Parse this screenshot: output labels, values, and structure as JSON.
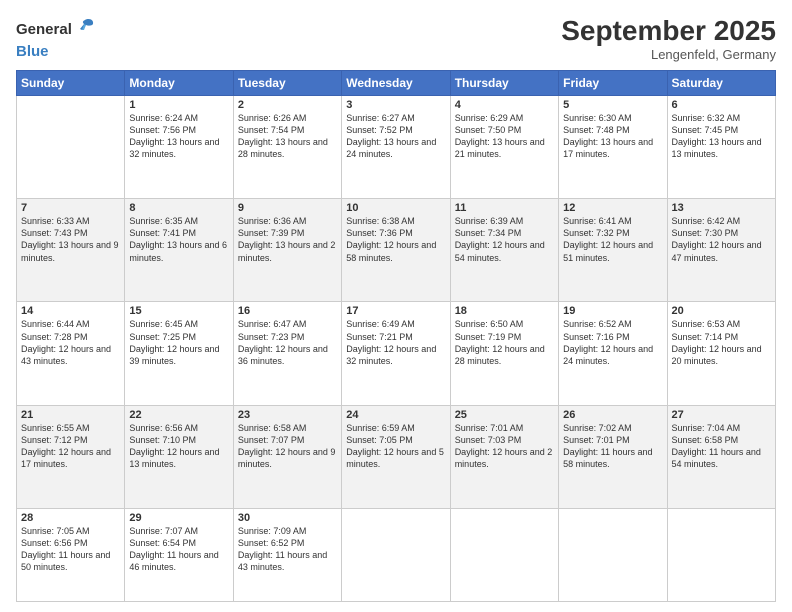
{
  "header": {
    "logo_general": "General",
    "logo_blue": "Blue",
    "month_title": "September 2025",
    "location": "Lengenfeld, Germany"
  },
  "days_of_week": [
    "Sunday",
    "Monday",
    "Tuesday",
    "Wednesday",
    "Thursday",
    "Friday",
    "Saturday"
  ],
  "weeks": [
    [
      {
        "day": "",
        "sunrise": "",
        "sunset": "",
        "daylight": ""
      },
      {
        "day": "1",
        "sunrise": "Sunrise: 6:24 AM",
        "sunset": "Sunset: 7:56 PM",
        "daylight": "Daylight: 13 hours and 32 minutes."
      },
      {
        "day": "2",
        "sunrise": "Sunrise: 6:26 AM",
        "sunset": "Sunset: 7:54 PM",
        "daylight": "Daylight: 13 hours and 28 minutes."
      },
      {
        "day": "3",
        "sunrise": "Sunrise: 6:27 AM",
        "sunset": "Sunset: 7:52 PM",
        "daylight": "Daylight: 13 hours and 24 minutes."
      },
      {
        "day": "4",
        "sunrise": "Sunrise: 6:29 AM",
        "sunset": "Sunset: 7:50 PM",
        "daylight": "Daylight: 13 hours and 21 minutes."
      },
      {
        "day": "5",
        "sunrise": "Sunrise: 6:30 AM",
        "sunset": "Sunset: 7:48 PM",
        "daylight": "Daylight: 13 hours and 17 minutes."
      },
      {
        "day": "6",
        "sunrise": "Sunrise: 6:32 AM",
        "sunset": "Sunset: 7:45 PM",
        "daylight": "Daylight: 13 hours and 13 minutes."
      }
    ],
    [
      {
        "day": "7",
        "sunrise": "Sunrise: 6:33 AM",
        "sunset": "Sunset: 7:43 PM",
        "daylight": "Daylight: 13 hours and 9 minutes."
      },
      {
        "day": "8",
        "sunrise": "Sunrise: 6:35 AM",
        "sunset": "Sunset: 7:41 PM",
        "daylight": "Daylight: 13 hours and 6 minutes."
      },
      {
        "day": "9",
        "sunrise": "Sunrise: 6:36 AM",
        "sunset": "Sunset: 7:39 PM",
        "daylight": "Daylight: 13 hours and 2 minutes."
      },
      {
        "day": "10",
        "sunrise": "Sunrise: 6:38 AM",
        "sunset": "Sunset: 7:36 PM",
        "daylight": "Daylight: 12 hours and 58 minutes."
      },
      {
        "day": "11",
        "sunrise": "Sunrise: 6:39 AM",
        "sunset": "Sunset: 7:34 PM",
        "daylight": "Daylight: 12 hours and 54 minutes."
      },
      {
        "day": "12",
        "sunrise": "Sunrise: 6:41 AM",
        "sunset": "Sunset: 7:32 PM",
        "daylight": "Daylight: 12 hours and 51 minutes."
      },
      {
        "day": "13",
        "sunrise": "Sunrise: 6:42 AM",
        "sunset": "Sunset: 7:30 PM",
        "daylight": "Daylight: 12 hours and 47 minutes."
      }
    ],
    [
      {
        "day": "14",
        "sunrise": "Sunrise: 6:44 AM",
        "sunset": "Sunset: 7:28 PM",
        "daylight": "Daylight: 12 hours and 43 minutes."
      },
      {
        "day": "15",
        "sunrise": "Sunrise: 6:45 AM",
        "sunset": "Sunset: 7:25 PM",
        "daylight": "Daylight: 12 hours and 39 minutes."
      },
      {
        "day": "16",
        "sunrise": "Sunrise: 6:47 AM",
        "sunset": "Sunset: 7:23 PM",
        "daylight": "Daylight: 12 hours and 36 minutes."
      },
      {
        "day": "17",
        "sunrise": "Sunrise: 6:49 AM",
        "sunset": "Sunset: 7:21 PM",
        "daylight": "Daylight: 12 hours and 32 minutes."
      },
      {
        "day": "18",
        "sunrise": "Sunrise: 6:50 AM",
        "sunset": "Sunset: 7:19 PM",
        "daylight": "Daylight: 12 hours and 28 minutes."
      },
      {
        "day": "19",
        "sunrise": "Sunrise: 6:52 AM",
        "sunset": "Sunset: 7:16 PM",
        "daylight": "Daylight: 12 hours and 24 minutes."
      },
      {
        "day": "20",
        "sunrise": "Sunrise: 6:53 AM",
        "sunset": "Sunset: 7:14 PM",
        "daylight": "Daylight: 12 hours and 20 minutes."
      }
    ],
    [
      {
        "day": "21",
        "sunrise": "Sunrise: 6:55 AM",
        "sunset": "Sunset: 7:12 PM",
        "daylight": "Daylight: 12 hours and 17 minutes."
      },
      {
        "day": "22",
        "sunrise": "Sunrise: 6:56 AM",
        "sunset": "Sunset: 7:10 PM",
        "daylight": "Daylight: 12 hours and 13 minutes."
      },
      {
        "day": "23",
        "sunrise": "Sunrise: 6:58 AM",
        "sunset": "Sunset: 7:07 PM",
        "daylight": "Daylight: 12 hours and 9 minutes."
      },
      {
        "day": "24",
        "sunrise": "Sunrise: 6:59 AM",
        "sunset": "Sunset: 7:05 PM",
        "daylight": "Daylight: 12 hours and 5 minutes."
      },
      {
        "day": "25",
        "sunrise": "Sunrise: 7:01 AM",
        "sunset": "Sunset: 7:03 PM",
        "daylight": "Daylight: 12 hours and 2 minutes."
      },
      {
        "day": "26",
        "sunrise": "Sunrise: 7:02 AM",
        "sunset": "Sunset: 7:01 PM",
        "daylight": "Daylight: 11 hours and 58 minutes."
      },
      {
        "day": "27",
        "sunrise": "Sunrise: 7:04 AM",
        "sunset": "Sunset: 6:58 PM",
        "daylight": "Daylight: 11 hours and 54 minutes."
      }
    ],
    [
      {
        "day": "28",
        "sunrise": "Sunrise: 7:05 AM",
        "sunset": "Sunset: 6:56 PM",
        "daylight": "Daylight: 11 hours and 50 minutes."
      },
      {
        "day": "29",
        "sunrise": "Sunrise: 7:07 AM",
        "sunset": "Sunset: 6:54 PM",
        "daylight": "Daylight: 11 hours and 46 minutes."
      },
      {
        "day": "30",
        "sunrise": "Sunrise: 7:09 AM",
        "sunset": "Sunset: 6:52 PM",
        "daylight": "Daylight: 11 hours and 43 minutes."
      },
      {
        "day": "",
        "sunrise": "",
        "sunset": "",
        "daylight": ""
      },
      {
        "day": "",
        "sunrise": "",
        "sunset": "",
        "daylight": ""
      },
      {
        "day": "",
        "sunrise": "",
        "sunset": "",
        "daylight": ""
      },
      {
        "day": "",
        "sunrise": "",
        "sunset": "",
        "daylight": ""
      }
    ]
  ]
}
